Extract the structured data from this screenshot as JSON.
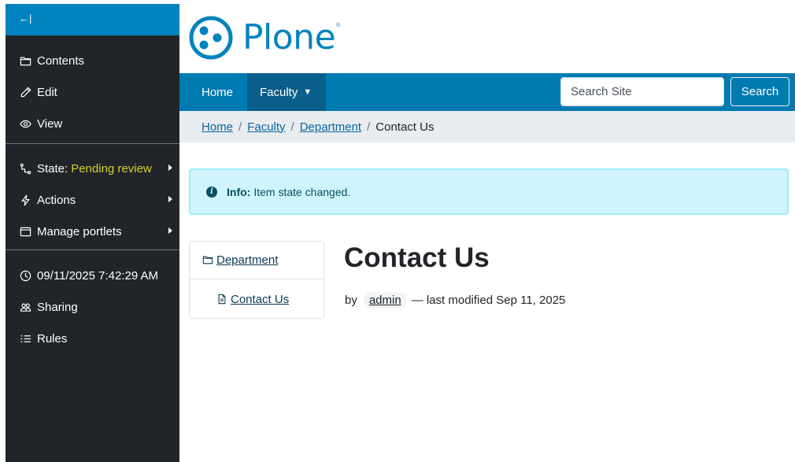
{
  "toolbar": {
    "collapse_label": "←|",
    "items": [
      {
        "label": "Contents",
        "icon": "folder-icon"
      },
      {
        "label": "Edit",
        "icon": "pencil-icon"
      },
      {
        "label": "View",
        "icon": "eye-icon"
      },
      {
        "label": "State:",
        "value": "Pending review",
        "icon": "state-icon"
      },
      {
        "label": "Actions",
        "icon": "lightning-icon"
      },
      {
        "label": "Manage portlets",
        "icon": "window-icon"
      },
      {
        "label": "09/11/2025 7:42:29 AM",
        "icon": "clock-icon"
      },
      {
        "label": "Sharing",
        "icon": "people-icon"
      },
      {
        "label": "Rules",
        "icon": "list-icon"
      }
    ]
  },
  "header": {
    "logo_text": "Plone",
    "logo_reg": "®"
  },
  "nav": {
    "items": [
      {
        "label": "Home"
      },
      {
        "label": "Faculty",
        "caret": "▼"
      }
    ],
    "search_placeholder": "Search Site",
    "search_button": "Search"
  },
  "breadcrumbs": {
    "items": [
      "Home",
      "Faculty",
      "Department"
    ],
    "current": "Contact Us",
    "separator": "/"
  },
  "alert": {
    "title": "Info:",
    "message": "Item state changed."
  },
  "portlet": {
    "items": [
      {
        "label": "Department",
        "icon": "folder-icon"
      },
      {
        "label": "Contact Us",
        "icon": "document-icon"
      }
    ]
  },
  "content": {
    "title": "Contact Us",
    "by": "by",
    "author": "admin",
    "modified": "— last modified Sep 11, 2025"
  },
  "colors": {
    "toolbar_bg": "#212529",
    "accent": "#0083be",
    "nav_bg": "#007bb1",
    "state_pending": "#d8d02a",
    "alert_bg": "#cff4fc"
  }
}
